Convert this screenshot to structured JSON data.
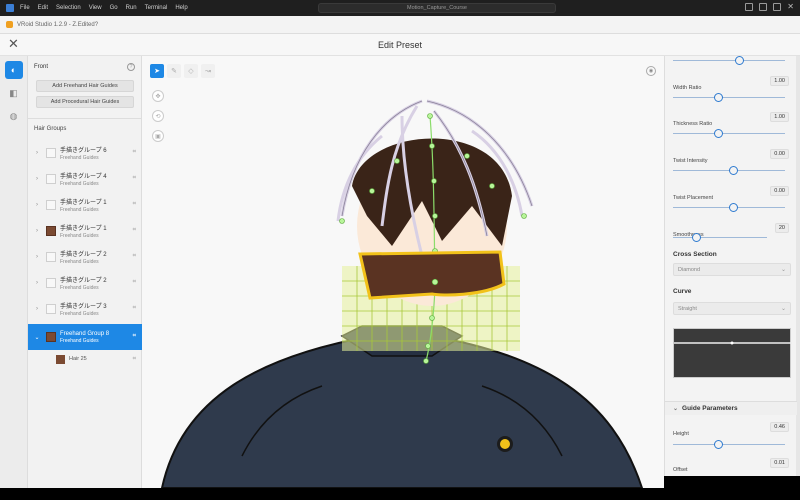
{
  "menubar": {
    "items": [
      "File",
      "Edit",
      "Selection",
      "View",
      "Go",
      "Run",
      "Terminal",
      "Help"
    ],
    "search": "Motion_Capture_Course"
  },
  "apptitle": {
    "text": "VRoid Studio 1.2.9 - Z.Edited?"
  },
  "header": {
    "title": "Edit Preset"
  },
  "rail": {
    "icons": [
      "hair-icon",
      "body-icon",
      "accessory-icon"
    ]
  },
  "panel": {
    "title": "Front",
    "add_freehand": "Add Freehand Hair Guides",
    "add_procedural": "Add Procedural Hair Guides",
    "section": "Hair Groups",
    "groups": [
      {
        "name": "手描きグループ 6",
        "sub": "Freehand Guides",
        "color": ""
      },
      {
        "name": "手描きグループ 4",
        "sub": "Freehand Guides",
        "color": ""
      },
      {
        "name": "手描きグループ 1",
        "sub": "Freehand Guides",
        "color": ""
      },
      {
        "name": "手描きグループ 1",
        "sub": "Freehand Guides",
        "color": "#7b4a32"
      },
      {
        "name": "手描きグループ 2",
        "sub": "Freehand Guides",
        "color": ""
      },
      {
        "name": "手描きグループ 2",
        "sub": "Freehand Guides",
        "color": ""
      },
      {
        "name": "手描きグループ 3",
        "sub": "Freehand Guides",
        "color": ""
      },
      {
        "name": "Freehand Group 8",
        "sub": "Freehand Guides",
        "color": "#7b4a32",
        "selected": true
      }
    ],
    "child": {
      "name": "Hair 25"
    }
  },
  "right": {
    "width_ratio": {
      "label": "Width Ratio",
      "value": "1.00",
      "pos": 0.37
    },
    "thickness_ratio": {
      "label": "Thickness Ratio",
      "value": "1.00",
      "pos": 0.37
    },
    "twist_intensity": {
      "label": "Twist Intensity",
      "value": "0.00",
      "pos": 0.5
    },
    "twist_placement": {
      "label": "Twist Placement",
      "value": "0.00",
      "pos": 0.5
    },
    "smoothness": {
      "label": "Smoothness",
      "value": "20",
      "pos": 0.2
    },
    "cross_section": {
      "label": "Cross Section",
      "value": "Diamond"
    },
    "curve": {
      "label": "Curve",
      "value": "Straight"
    },
    "guide_parameters": "Guide Parameters",
    "height": {
      "label": "Height",
      "value": "0.46",
      "pos": 0.37
    },
    "offset": {
      "label": "Offset",
      "value": "0.01"
    }
  }
}
